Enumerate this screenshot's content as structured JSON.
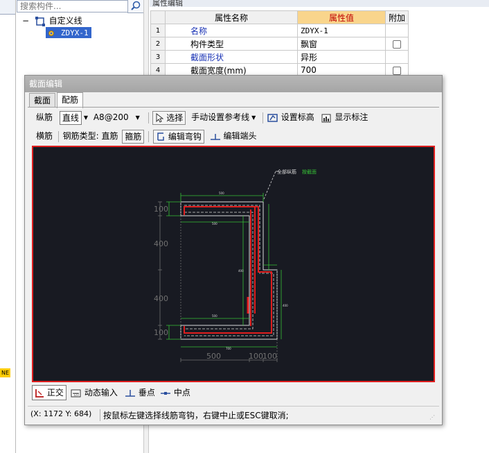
{
  "search": {
    "placeholder": "搜索构件..."
  },
  "tree": {
    "parent": "自定义线",
    "child": "ZDYX-1",
    "ne_tag": "NE"
  },
  "properties": {
    "panel_title": "属性编辑",
    "headers": {
      "name": "属性名称",
      "value": "属性值",
      "extra": "附加"
    },
    "rows": [
      {
        "no": "1",
        "name": "名称",
        "value": "ZDYX-1",
        "checkbox": false
      },
      {
        "no": "2",
        "name": "构件类型",
        "value": "飘窗",
        "checkbox": true
      },
      {
        "no": "3",
        "name": "截面形状",
        "value": "异形",
        "checkbox": false
      },
      {
        "no": "4",
        "name": "截面宽度(mm)",
        "value": "700",
        "checkbox": true
      }
    ]
  },
  "dialog": {
    "title": "截面编辑",
    "tabs": [
      "截面",
      "配筋"
    ],
    "active_tab": "配筋",
    "toolbar1": {
      "label": "纵筋",
      "mode": "直线",
      "spec": "A8@200",
      "select": "选择",
      "manual_ref": "手动设置参考线",
      "set_elevation": "设置标高",
      "show_labels": "显示标注"
    },
    "toolbar2": {
      "label": "横筋",
      "rebar_type_label": "钢筋类型: 直筋",
      "stirrup": "箍筋",
      "edit_hook": "编辑弯钩",
      "edit_end": "编辑端头"
    },
    "drawing": {
      "annotation_left": "全部纵筋",
      "annotation_right": "按截面",
      "dims_left": [
        "100",
        "400",
        "400",
        "100"
      ],
      "dims_bottom": [
        "500",
        "100",
        "100"
      ]
    },
    "bottom_tools": {
      "ortho": "正交",
      "dynamic_input": "动态输入",
      "perpendicular": "垂点",
      "midpoint": "中点"
    },
    "status": {
      "coords": "(X: 1172 Y: 684)",
      "message": "按鼠标左键选择线筋弯钩，右键中止或ESC键取消;"
    }
  },
  "colors": {
    "canvas_bg": "#181a22",
    "canvas_border": "#e01e1e",
    "rebar": "#e01e1e",
    "outline": "#d9d9d9",
    "dim": "#36c236",
    "value_header": "#f9d58c"
  }
}
